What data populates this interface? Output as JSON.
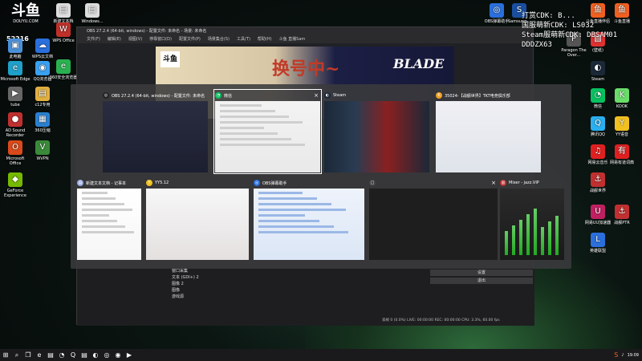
{
  "douyu": {
    "logo_text": "斗鱼",
    "domain": "DOUYU.COM",
    "room_id": "52216"
  },
  "overlay": {
    "lines": [
      "打赏CDK: B...",
      "国服萌新CDK: LS032",
      "Steam服萌新CDK: DBSAM01",
      "DDDZX63"
    ]
  },
  "desktop_icons_left": [
    {
      "label": "此电脑",
      "icon": "computer-icon",
      "color": "#4a90d9"
    },
    {
      "label": "WPS云文档",
      "icon": "wps-cloud-icon",
      "color": "#2a6fdb"
    },
    {
      "label": "Microsoft Edge",
      "icon": "edge-icon",
      "color": "#1fa0c8"
    },
    {
      "label": "QQ浏览器",
      "icon": "qq-browser-icon",
      "color": "#3aa0f0"
    },
    {
      "label": "tube",
      "icon": "tube-icon",
      "color": "#666"
    },
    {
      "label": "c12专用",
      "icon": "folder-icon",
      "color": "#e0b040"
    },
    {
      "label": "AD Sound Recorder",
      "icon": "recorder-icon",
      "color": "#c03030"
    },
    {
      "label": "360压缩",
      "icon": "zip-icon",
      "color": "#2a80d0"
    },
    {
      "label": "Microsoft Office",
      "icon": "office-icon",
      "color": "#d84a1b"
    },
    {
      "label": "WVPN",
      "icon": "vpn-icon",
      "color": "#3a8a3a"
    },
    {
      "label": "GeForce Experience",
      "icon": "geforce-icon",
      "color": "#76b900"
    }
  ],
  "desktop_icons_top": [
    {
      "label": "新建文本档",
      "icon": "text-file-icon",
      "color": "#ddd"
    },
    {
      "label": "Windows...",
      "icon": "windows-file-icon",
      "color": "#ddd"
    },
    {
      "label": "WPS Office",
      "icon": "wps-icon",
      "color": "#c0302a"
    },
    {
      "label": "360安全浏览器",
      "icon": "360-browser-icon",
      "color": "#2ab050"
    }
  ],
  "desktop_icons_right": [
    {
      "label": "OBS弹幕助手",
      "icon": "obs-helper-icon",
      "color": "#2a6fdb"
    },
    {
      "label": "Samsung...",
      "icon": "samsung-icon",
      "color": "#1a4fa0"
    },
    {
      "label": "斗鱼直播伴侣",
      "icon": "douyu-app-icon",
      "color": "#f06020"
    },
    {
      "label": "斗鱼直播",
      "icon": "douyu-live-icon",
      "color": "#f06020"
    },
    {
      "label": "Paragon The Over...",
      "icon": "paragon-icon",
      "color": "#555"
    },
    {
      "label": "(壁纸)",
      "icon": "wallpaper-icon",
      "color": "#e03030"
    },
    {
      "label": "Steam",
      "icon": "steam-icon",
      "color": "#1b2838"
    },
    {
      "label": "微信",
      "icon": "wechat-icon",
      "color": "#07c160"
    },
    {
      "label": "KOOK",
      "icon": "kook-icon",
      "color": "#6adc6a"
    },
    {
      "label": "腾讯QQ",
      "icon": "qq-icon",
      "color": "#2ab0f0"
    },
    {
      "label": "YY语音",
      "icon": "yy-icon",
      "color": "#f0c020"
    },
    {
      "label": "网易云音乐",
      "icon": "netease-music-icon",
      "color": "#e02020"
    },
    {
      "label": "网易有道词典",
      "icon": "youdao-icon",
      "color": "#e02020"
    },
    {
      "label": "战舰世界",
      "icon": "warships-icon",
      "color": "#c03030"
    },
    {
      "label": "网易UU加速器",
      "icon": "uu-icon",
      "color": "#c02060"
    },
    {
      "label": "战舰PTR",
      "icon": "ptr-icon",
      "color": "#c03030"
    },
    {
      "label": "英雄联盟",
      "icon": "lol-icon",
      "color": "#2a6fdb"
    }
  ],
  "obs": {
    "title": "OBS 27.2.4 (64-bit, windows) - 配置文件: 未命名 - 场景: 未命名",
    "menu": [
      "文件(F)",
      "编辑(E)",
      "视图(V)",
      "停靠窗口(D)",
      "配置文件(P)",
      "场景集合(S)",
      "工具(T)",
      "帮助(H)",
      "斗鱼 直播Sam"
    ],
    "banner_logo": "斗鱼",
    "banner_text": "换号中~",
    "banner_title": "BLADE",
    "sources": [
      "窗口采集",
      "文本 (GDI+) 2",
      "图像 2",
      "图像",
      "游戏源"
    ],
    "buttons": [
      "设置",
      "退出"
    ],
    "status": "丢帧 0 (0.0%)   LIVE: 00:00:00   REC: 00:00:00   CPU: 3.3%, 60.00 fps"
  },
  "switcher": {
    "thumbs": [
      {
        "title": "OBS 27.2.4 (64-bit, windows) - 配置文件: 未命名",
        "icon": "obs-icon",
        "icon_color": "#222",
        "selected": false
      },
      {
        "title": "微信",
        "icon": "wechat-icon",
        "icon_color": "#07c160",
        "selected": true
      },
      {
        "title": "Steam",
        "icon": "steam-icon",
        "icon_color": "#1b2838",
        "selected": false
      },
      {
        "title": "35024-【战舰世界】TKT电竞俱乐部",
        "icon": "kook-icon",
        "icon_color": "#f0a020",
        "selected": false
      },
      {
        "title": "新建文本文档 - 记事本",
        "icon": "notepad-icon",
        "icon_color": "#9ad",
        "selected": false
      },
      {
        "title": "YY5.12",
        "icon": "yy-icon",
        "icon_color": "#f0c020",
        "selected": false
      },
      {
        "title": "OBS弹幕助手",
        "icon": "obs-helper-icon",
        "icon_color": "#2a6fdb",
        "selected": false
      },
      {
        "title": "",
        "icon": "blank-window-icon",
        "icon_color": "#444",
        "selected": false
      },
      {
        "title": "Mixer - jazz.VIP",
        "icon": "mixer-icon",
        "icon_color": "#c03030",
        "selected": false
      }
    ]
  },
  "taskbar": {
    "time": "19:09",
    "items": [
      "start-icon",
      "search-icon",
      "task-view-icon",
      "edge-icon",
      "explorer-icon",
      "wechat-icon",
      "qq-icon",
      "folder-icon",
      "steam-icon",
      "obs-icon",
      "chrome-icon",
      "media-icon"
    ]
  }
}
